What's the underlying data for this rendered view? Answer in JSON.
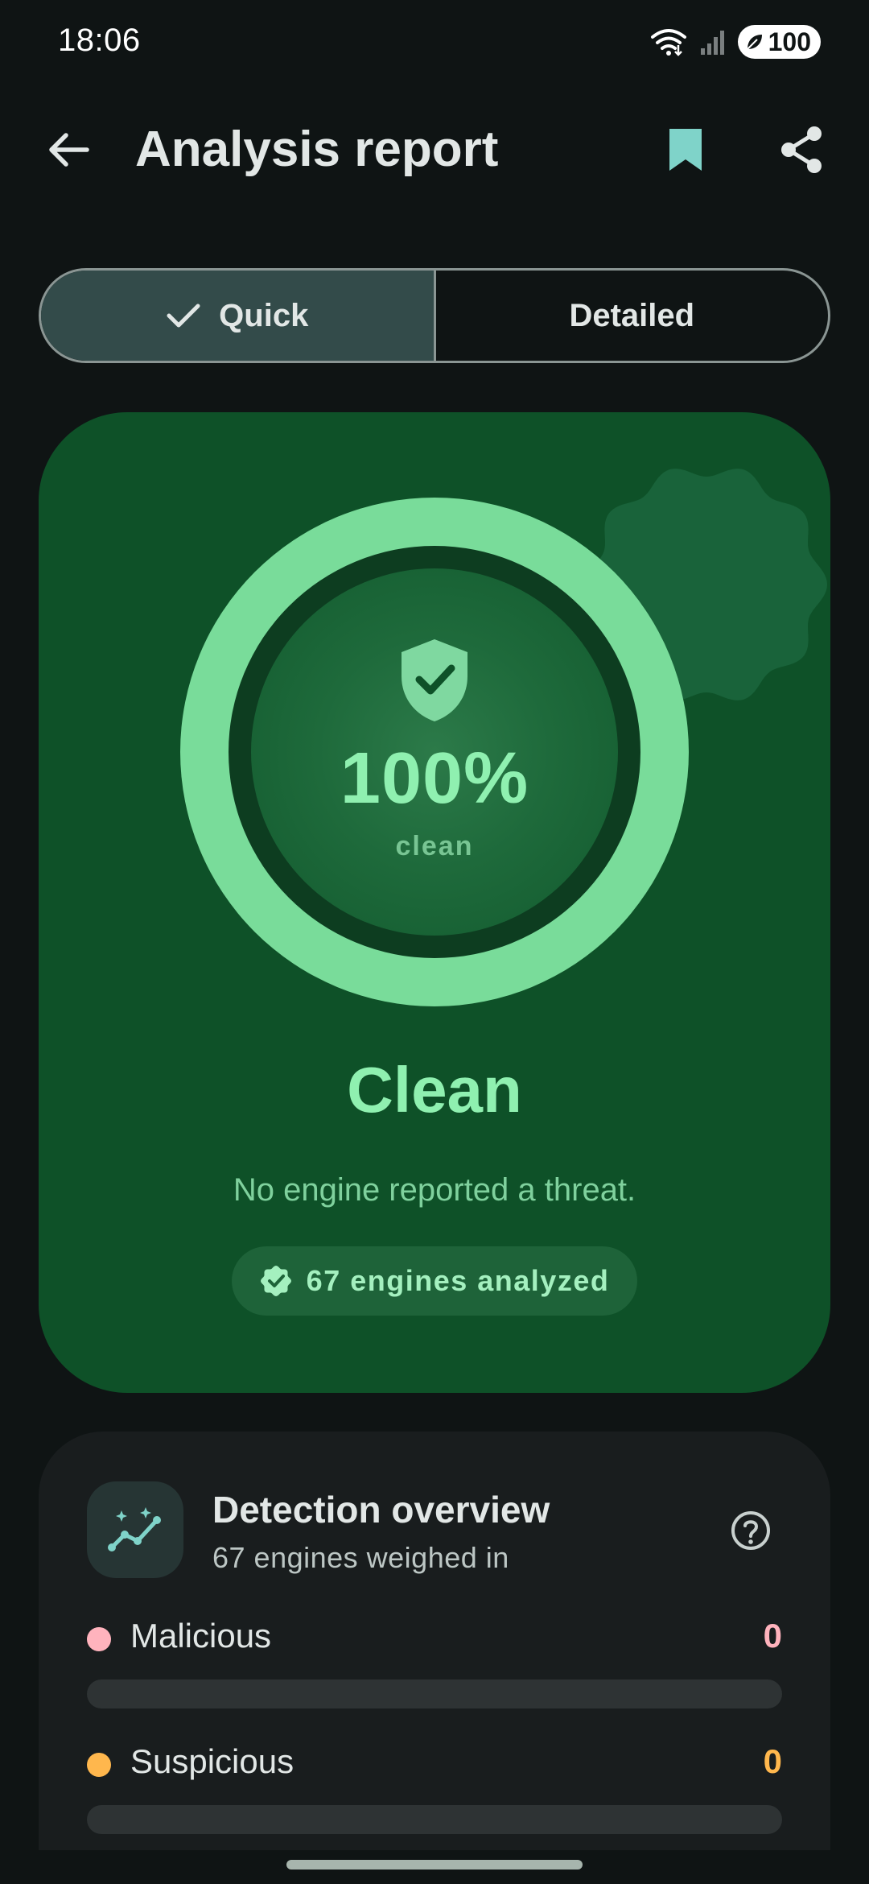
{
  "status_bar": {
    "time": "18:06",
    "battery": "100",
    "icons": [
      "wifi-icon",
      "signal-icon",
      "battery-saver-icon"
    ]
  },
  "app_bar": {
    "title": "Analysis report",
    "actions": [
      "back-arrow-icon",
      "bookmark-icon",
      "share-icon"
    ]
  },
  "tabs": {
    "selected": "quick",
    "quick_label": "Quick",
    "detailed_label": "Detailed"
  },
  "result": {
    "percent": "100%",
    "percent_value": 100,
    "percent_caption": "clean",
    "verdict": "Clean",
    "description": "No engine reported a threat.",
    "engines_chip": "67 engines analyzed"
  },
  "overview": {
    "title": "Detection overview",
    "subtitle": "67 engines weighed in",
    "total_engines": 67,
    "metrics": [
      {
        "label": "Malicious",
        "value": "0",
        "count": 0,
        "color": "#ffb3bd"
      },
      {
        "label": "Suspicious",
        "value": "0",
        "count": 0,
        "color": "#ffb74d"
      }
    ]
  },
  "colors": {
    "background": "#0f1414",
    "card_green": "#0e5128",
    "ring_green": "#79dc9a",
    "accent_teal": "#7fd3c9"
  }
}
